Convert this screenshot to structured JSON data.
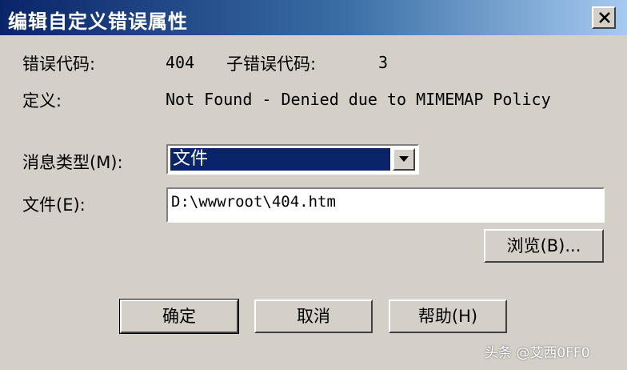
{
  "window": {
    "title": "编辑自定义错误属性"
  },
  "error": {
    "code_label": "错误代码:",
    "code_value": "404",
    "subcode_label": "子错误代码:",
    "subcode_value": "3",
    "definition_label": "定义:",
    "definition_value": "Not Found - Denied due to MIMEMAP Policy"
  },
  "message_type": {
    "label": "消息类型(M):",
    "selected": "文件"
  },
  "file": {
    "label": "文件(E):",
    "value": "D:\\wwwroot\\404.htm"
  },
  "buttons": {
    "browse": "浏览(B)...",
    "ok": "确定",
    "cancel": "取消",
    "help": "帮助(H)"
  },
  "watermark": "头条 @艾西0FF0",
  "icons": {
    "close": "close-icon",
    "dropdown": "chevron-down-icon"
  },
  "colors": {
    "title_bar": "#0a246a",
    "selection": "#0a246a",
    "dialog_bg": "#d4d0c8"
  }
}
